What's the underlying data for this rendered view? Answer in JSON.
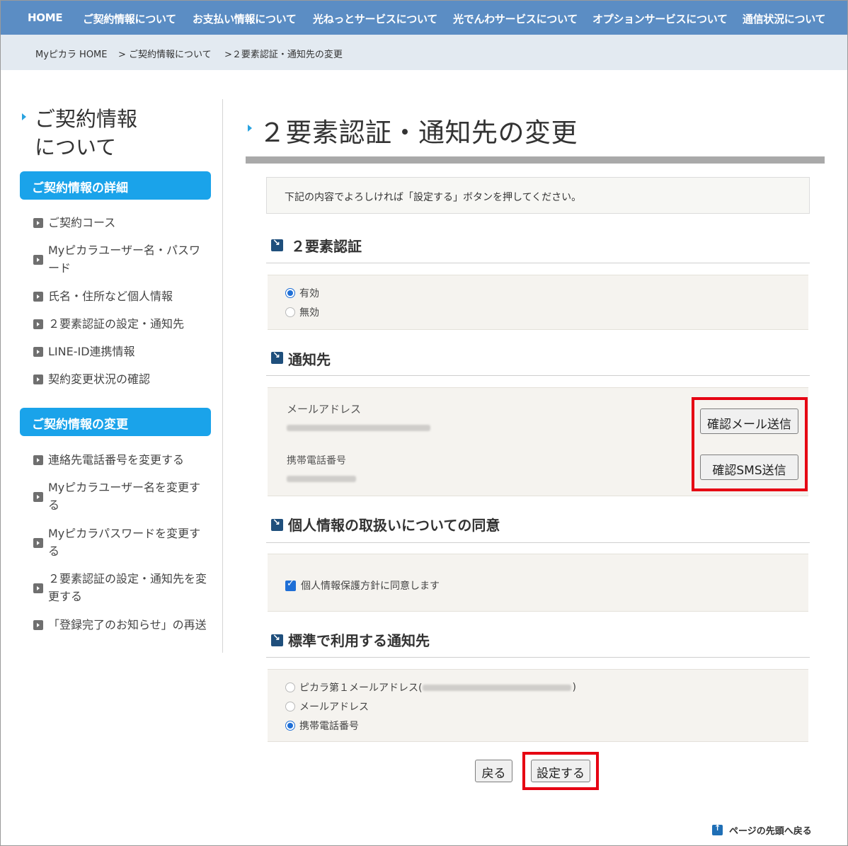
{
  "nav": {
    "items": [
      "HOME",
      "ご契約情報について",
      "お支払い情報について",
      "光ねっとサービスについて",
      "光でんわサービスについて",
      "オプションサービスについて",
      "通信状況について"
    ]
  },
  "breadcrumb": {
    "items": [
      "Myピカラ HOME",
      "> ご契約情報について",
      ">２要素認証・通知先の変更"
    ]
  },
  "sidebar": {
    "title_line1": "ご契約情報",
    "title_line2": "について",
    "group1_heading": "ご契約情報の詳細",
    "group1_links": [
      "ご契約コース",
      "Myピカラユーザー名・パスワード",
      "氏名・住所など個人情報",
      "２要素認証の設定・通知先",
      "LINE-ID連携情報",
      "契約変更状況の確認"
    ],
    "group2_heading": "ご契約情報の変更",
    "group2_links": [
      "連絡先電話番号を変更する",
      "Myピカラユーザー名を変更する",
      "Myピカラパスワードを変更する",
      "２要素認証の設定・通知先を変更する",
      "「登録完了のお知らせ」の再送"
    ]
  },
  "main": {
    "title": "２要素認証・通知先の変更",
    "notice": "下記の内容でよろしければ「設定する」ボタンを押してください。",
    "twofa": {
      "heading": "２要素認証",
      "options": [
        "有効",
        "無効"
      ],
      "selected": "有効"
    },
    "notify": {
      "heading": "通知先",
      "email_label": "メールアドレス",
      "phone_label": "携帯電話番号",
      "email_button": "確認メール送信",
      "sms_button": "確認SMS送信"
    },
    "consent": {
      "heading": "個人情報の取扱いについての同意",
      "checkbox_label": "個人情報保護方針に同意します",
      "checked": true
    },
    "default_notify": {
      "heading": "標準で利用する通知先",
      "option1_prefix": "ピカラ第１メールアドレス(",
      "option1_suffix": ")",
      "option2": "メールアドレス",
      "option3": "携帯電話番号",
      "selected": "携帯電話番号"
    },
    "back_button": "戻る",
    "submit_button": "設定する"
  },
  "footer": {
    "page_top": "ページの先頭へ戻る"
  },
  "colors": {
    "nav_bg": "#5b8dc4",
    "breadcrumb_bg": "#e3eaf1",
    "sidebar_heading_bg": "#1aa3ea",
    "highlight_red": "#e60012",
    "panel_bg": "#f5f3ef"
  }
}
